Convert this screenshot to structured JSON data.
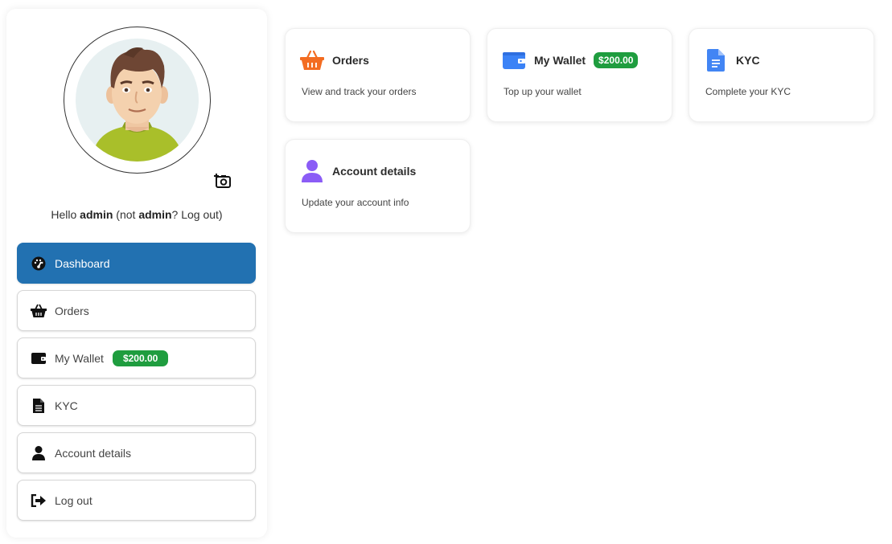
{
  "user": {
    "hello": "Hello ",
    "username": "admin",
    "not_prefix": " (not ",
    "username2": "admin",
    "logout_suffix": "? Log out)"
  },
  "sidebar": {
    "items": [
      {
        "label": "Dashboard",
        "icon": "dashboard-icon",
        "active": true
      },
      {
        "label": "Orders",
        "icon": "basket-icon"
      },
      {
        "label": "My Wallet",
        "icon": "wallet-icon",
        "badge": "$200.00"
      },
      {
        "label": "KYC",
        "icon": "document-icon"
      },
      {
        "label": "Account details",
        "icon": "user-icon"
      },
      {
        "label": "Log out",
        "icon": "logout-icon"
      }
    ]
  },
  "cards": [
    {
      "title": "Orders",
      "desc": "View and track your orders",
      "icon": "basket-icon"
    },
    {
      "title": "My Wallet",
      "desc": "Top up your wallet",
      "icon": "wallet-icon",
      "badge": "$200.00"
    },
    {
      "title": "KYC",
      "desc": "Complete your KYC",
      "icon": "document-icon"
    },
    {
      "title": "Account details",
      "desc": "Update your account info",
      "icon": "user-icon"
    }
  ],
  "colors": {
    "active": "#2271b1",
    "badge": "#1f9d3f",
    "orders_icon": "#f36c21",
    "wallet_icon": "#3b82f6",
    "kyc_icon": "#4285f4",
    "account_icon": "#8b5cf6"
  }
}
